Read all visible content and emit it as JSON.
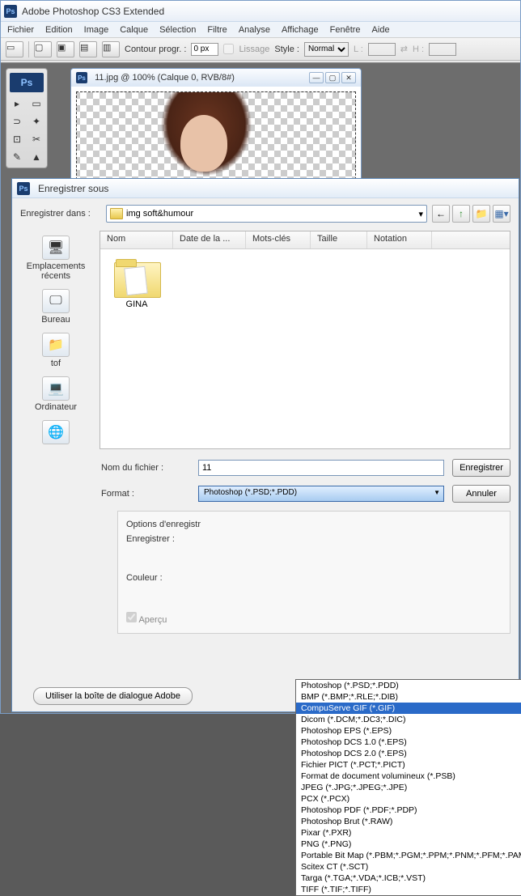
{
  "app": {
    "title": "Adobe Photoshop CS3 Extended"
  },
  "menu": [
    "Fichier",
    "Edition",
    "Image",
    "Calque",
    "Sélection",
    "Filtre",
    "Analyse",
    "Affichage",
    "Fenêtre",
    "Aide"
  ],
  "options": {
    "contour_label": "Contour progr. :",
    "contour_value": "0 px",
    "lissage": "Lissage",
    "style_label": "Style :",
    "style_value": "Normal",
    "L": "L :",
    "H": "H :"
  },
  "doc": {
    "title": "11.jpg @ 100% (Calque 0, RVB/8#)"
  },
  "save": {
    "title": "Enregistrer sous",
    "path_label": "Enregistrer dans :",
    "path_value": "img soft&humour",
    "places": [
      "Emplacements récents",
      "Bureau",
      "tof",
      "Ordinateur",
      ""
    ],
    "columns": [
      "Nom",
      "Date de la ...",
      "Mots-clés",
      "Taille",
      "Notation"
    ],
    "folder": "GINA",
    "filename_label": "Nom du fichier :",
    "filename_value": "11",
    "format_label": "Format :",
    "format_value": "Photoshop (*.PSD;*.PDD)",
    "save_btn": "Enregistrer",
    "cancel_btn": "Annuler",
    "options_label": "Options d'enregistr",
    "enregistrer_label": "Enregistrer :",
    "couleur_label": "Couleur :",
    "apercu": "Aperçu",
    "adobe_btn": "Utiliser la boîte de dialogue Adobe"
  },
  "formats": [
    "Photoshop (*.PSD;*.PDD)",
    "BMP (*.BMP;*.RLE;*.DIB)",
    "CompuServe GIF (*.GIF)",
    "Dicom (*.DCM;*.DC3;*.DIC)",
    "Photoshop EPS (*.EPS)",
    "Photoshop DCS 1.0 (*.EPS)",
    "Photoshop DCS 2.0 (*.EPS)",
    "Fichier PICT (*.PCT;*.PICT)",
    "Format de document volumineux (*.PSB)",
    "JPEG (*.JPG;*.JPEG;*.JPE)",
    "PCX (*.PCX)",
    "Photoshop PDF (*.PDF;*.PDP)",
    "Photoshop Brut (*.RAW)",
    "Pixar (*.PXR)",
    "PNG (*.PNG)",
    "Portable Bit Map (*.PBM;*.PGM;*.PPM;*.PNM;*.PFM;*.PAM)",
    "Scitex CT (*.SCT)",
    "Targa (*.TGA;*.VDA;*.ICB;*.VST)",
    "TIFF (*.TIF;*.TIFF)"
  ],
  "formats_selected_index": 2
}
